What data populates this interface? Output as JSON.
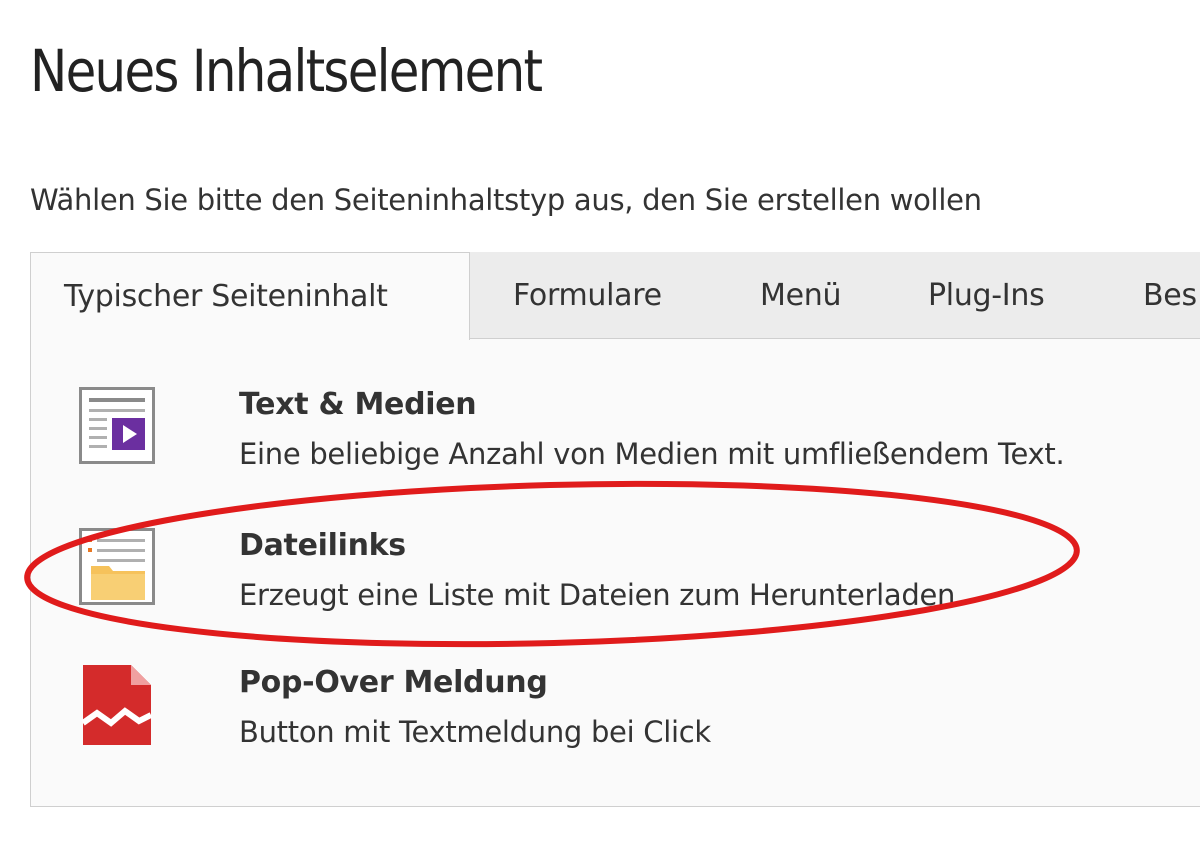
{
  "page": {
    "title": "Neues Inhaltselement",
    "subtitle": "Wählen Sie bitte den Seiteninhaltstyp aus, den Sie erstellen wollen"
  },
  "tabs": [
    {
      "label": "Typischer Seiteninhalt",
      "active": true
    },
    {
      "label": "Formulare",
      "active": false
    },
    {
      "label": "Menü",
      "active": false
    },
    {
      "label": "Plug-Ins",
      "active": false
    },
    {
      "label": "Bes",
      "active": false
    }
  ],
  "items": [
    {
      "title": "Text & Medien",
      "description": "Eine beliebige Anzahl von Medien mit umfließendem Text.",
      "icon": "text-media-icon"
    },
    {
      "title": "Dateilinks",
      "description": "Erzeugt eine Liste mit Dateien zum Herunterladen.",
      "icon": "file-links-icon"
    },
    {
      "title": "Pop-Over Meldung",
      "description": "Button mit Textmeldung bei Click",
      "icon": "popover-icon"
    }
  ],
  "highlight": {
    "target": "Dateilinks",
    "color": "#e01b1b"
  },
  "colors": {
    "tab_strip": "#ececec",
    "panel_bg": "#fafafa",
    "media_accent": "#6b2fa0",
    "folder": "#f6c25b",
    "popover_red": "#d42b2b"
  }
}
